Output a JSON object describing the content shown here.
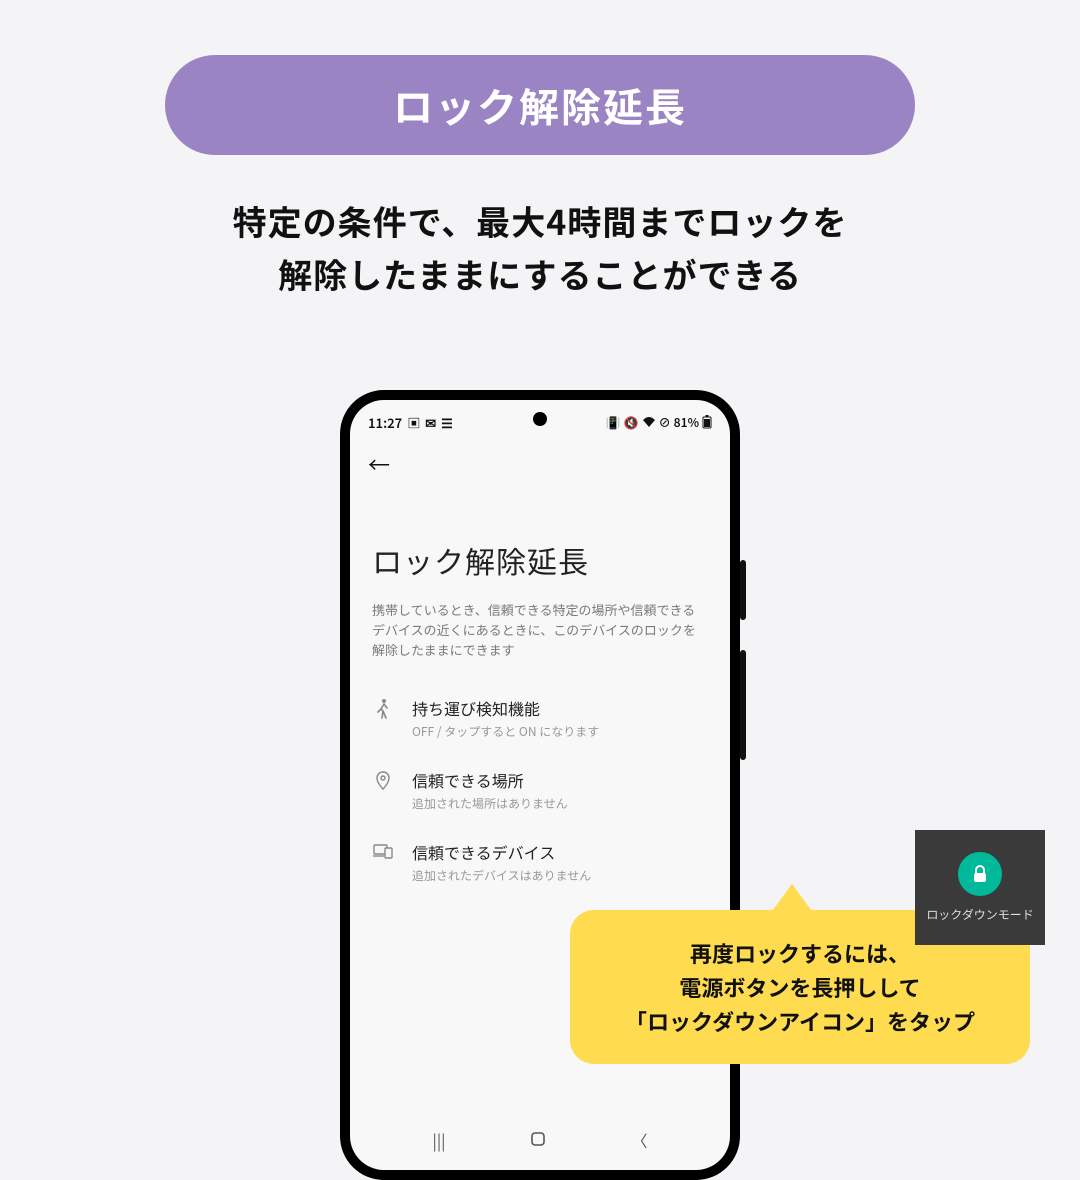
{
  "header": {
    "pill": "ロック解除延長",
    "subtitle_line1": "特定の条件で、最大4時間までロックを",
    "subtitle_line2": "解除したままにすることができる"
  },
  "phone": {
    "status": {
      "time": "11:27",
      "battery_text": "81%"
    },
    "page_title": "ロック解除延長",
    "page_desc": "携帯しているとき、信頼できる特定の場所や信頼できるデバイスの近くにあるときに、このデバイスのロックを解除したままにできます",
    "rows": [
      {
        "primary": "持ち運び検知機能",
        "secondary": "OFF / タップすると ON になります"
      },
      {
        "primary": "信頼できる場所",
        "secondary": "追加された場所はありません"
      },
      {
        "primary": "信頼できるデバイス",
        "secondary": "追加されたデバイスはありません"
      }
    ]
  },
  "bubble": {
    "line1": "再度ロックするには、",
    "line2": "電源ボタンを長押しして",
    "line3": "「ロックダウンアイコン」をタップ"
  },
  "lockdown": {
    "label": "ロックダウンモード"
  }
}
